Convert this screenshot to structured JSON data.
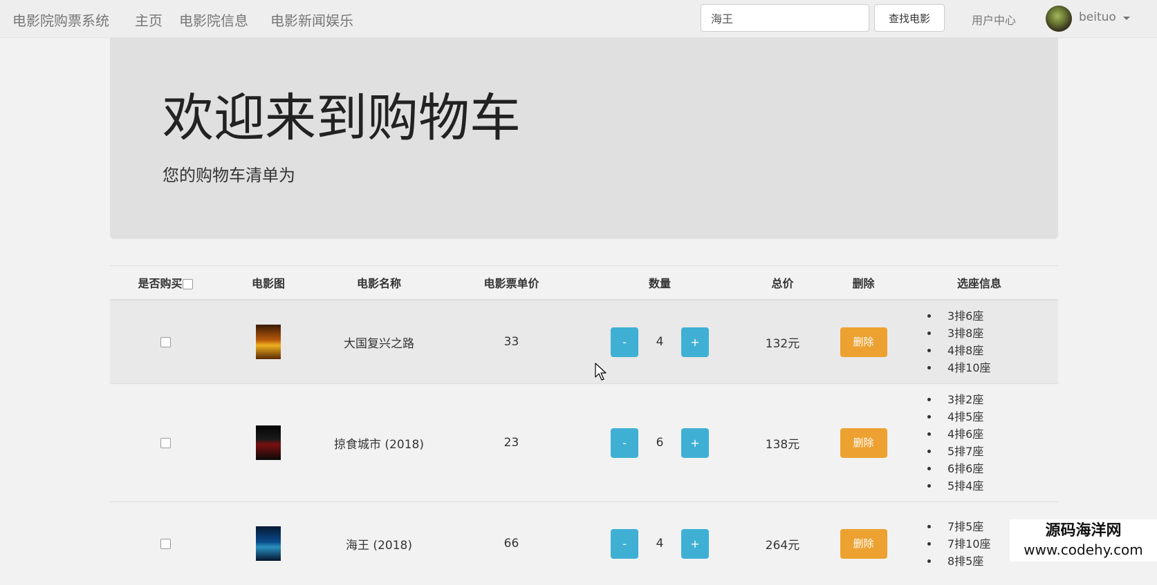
{
  "navbar": {
    "brand": "电影院购票系统",
    "links": [
      "主页",
      "电影院信息",
      "电影新闻娱乐"
    ],
    "search_value": "海王",
    "search_button": "查找电影",
    "user_center": "用户中心",
    "username": "beituo"
  },
  "jumbotron": {
    "title": "欢迎来到购物车",
    "subtitle": "您的购物车清单为"
  },
  "table": {
    "headers": [
      "是否购买",
      "电影图",
      "电影名称",
      "电影票单价",
      "数量",
      "总价",
      "删除",
      "选座信息"
    ],
    "rows": [
      {
        "name": "大国复兴之路",
        "price": "33",
        "qty": "4",
        "total": "132元",
        "seats": [
          "3排6座",
          "3排8座",
          "4排8座",
          "4排10座"
        ]
      },
      {
        "name": "掠食城市 (2018)",
        "price": "23",
        "qty": "6",
        "total": "138元",
        "seats": [
          "3排2座",
          "4排5座",
          "4排6座",
          "5排7座",
          "6排6座",
          "5排4座"
        ]
      },
      {
        "name": "海王 (2018)",
        "price": "66",
        "qty": "4",
        "total": "264元",
        "seats": [
          "7排5座",
          "7排10座",
          "8排5座"
        ]
      }
    ],
    "minus_label": "-",
    "plus_label": "+",
    "delete_label": "删除"
  },
  "watermark": {
    "line1": "源码海洋网",
    "line2": "www.codehy.com"
  },
  "colors": {
    "navbar_bg": "#eeeeee",
    "jumbotron_bg": "#e0e0e0",
    "qty_button": "#3fb0d4",
    "delete_button": "#eca130"
  }
}
